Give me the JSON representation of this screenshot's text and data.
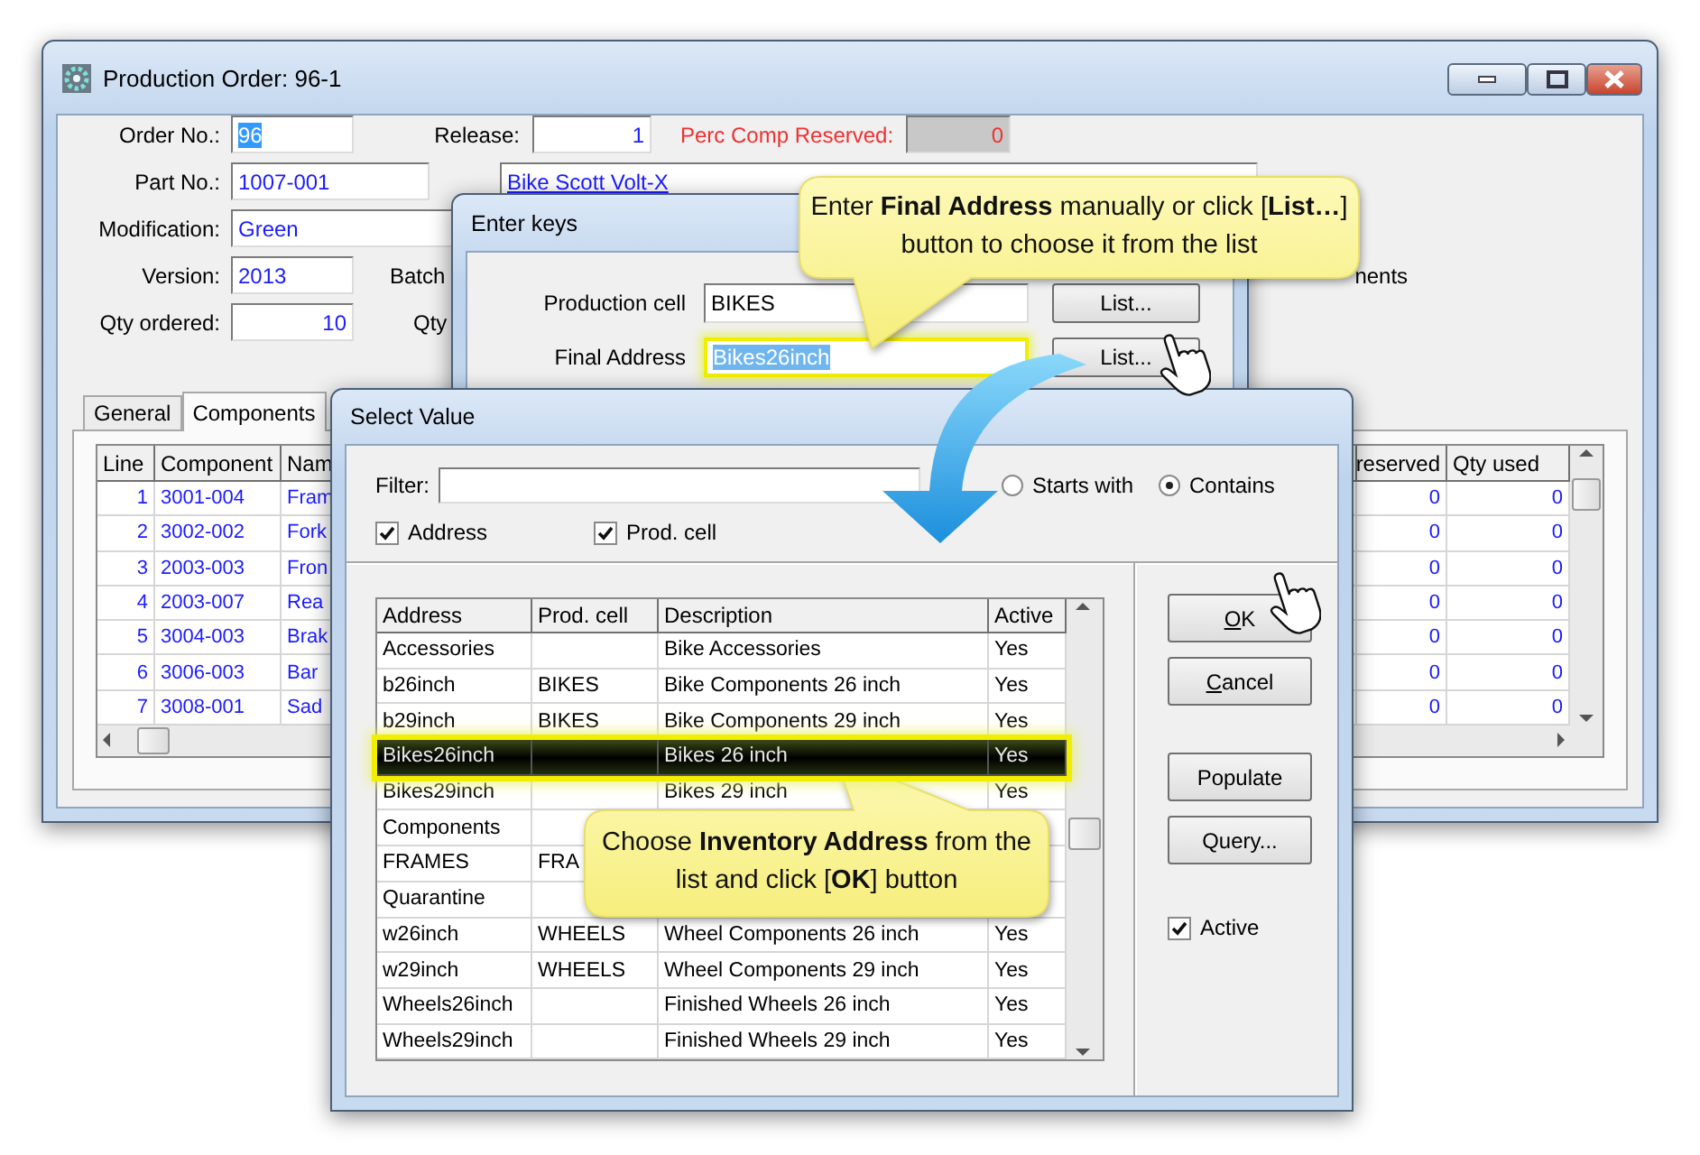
{
  "main_window": {
    "title": "Production Order: 96-1",
    "form_rows": [
      [
        {
          "label": "Order No.:",
          "value": "96",
          "kind": "text",
          "selected": true
        },
        {
          "label": "Release:",
          "value": "1",
          "kind": "number",
          "selected": false
        },
        {
          "label": "Perc Comp Reserved:",
          "value": "0",
          "kind": "readonly",
          "selected": false
        }
      ],
      [
        {
          "label": "Part No.:",
          "value": "1007-001",
          "kind": "text",
          "selected": false
        },
        {
          "value": "Bike Scott Volt-X",
          "kind": "description",
          "selected": false
        }
      ],
      [
        {
          "label": "Modification:",
          "value": "Green",
          "kind": "text",
          "selected": false
        }
      ],
      [
        {
          "label": "Version:",
          "value": "2013",
          "kind": "text",
          "selected": false
        },
        {
          "label": "Batch"
        },
        {
          "label": "nents"
        }
      ],
      [
        {
          "label": "Qty ordered:",
          "value": "10",
          "kind": "number",
          "selected": false
        },
        {
          "label": "Qty"
        }
      ]
    ],
    "tabs": [
      {
        "label": "General",
        "selected": false
      },
      {
        "label": "Components",
        "selected": true
      }
    ],
    "table": {
      "columns": [
        "Line",
        "Component",
        "Nam",
        "reserved",
        "Qty used"
      ],
      "rows": [
        [
          "1",
          "3001-004",
          "Fram",
          "0",
          "0"
        ],
        [
          "2",
          "3002-002",
          "Fork",
          "0",
          "0"
        ],
        [
          "3",
          "2003-003",
          "Fron",
          "0",
          "0"
        ],
        [
          "4",
          "2003-007",
          "Rea",
          "0",
          "0"
        ],
        [
          "5",
          "3004-003",
          "Brak",
          "0",
          "0"
        ],
        [
          "6",
          "3006-003",
          "Bar",
          "0",
          "0"
        ],
        [
          "7",
          "3008-001",
          "Sad",
          "0",
          "0"
        ]
      ]
    }
  },
  "enter_keys": {
    "title": "Enter keys",
    "fields": [
      {
        "label": "Production cell",
        "value": "BIKES",
        "selected": false,
        "highlighted": false,
        "button": "List..."
      },
      {
        "label": "Final Address",
        "value": "Bikes26inch",
        "selected": true,
        "highlighted": true,
        "button": "List..."
      }
    ]
  },
  "select_value": {
    "title": "Select Value",
    "filter": {
      "label": "Filter:"
    },
    "match_options": [
      {
        "label": "Starts with",
        "selected": false
      },
      {
        "label": "Contains",
        "selected": true
      }
    ],
    "search_in": [
      {
        "label": "Address",
        "checked": true
      },
      {
        "label": "Prod. cell",
        "checked": true
      }
    ],
    "table": {
      "columns": [
        "Address",
        "Prod. cell",
        "Description",
        "Active"
      ],
      "rows": [
        {
          "address": "Accessories",
          "description": "Bike Accessories",
          "active": "Yes",
          "selected": false
        },
        {
          "address": "b26inch",
          "prod_cell": "BIKES",
          "description": "Bike Components 26 inch",
          "active": "Yes",
          "selected": false
        },
        {
          "address": "b29inch",
          "prod_cell": "BIKES",
          "description": "Bike Components 29 inch",
          "active": "Yes",
          "selected": false
        },
        {
          "address": "Bikes26inch",
          "description": "Bikes 26 inch",
          "active": "Yes",
          "selected": true
        },
        {
          "address": "Bikes29inch",
          "description": "Bikes 29 inch",
          "active": "Yes",
          "selected": false
        },
        {
          "address": "Components",
          "selected": false
        },
        {
          "address": "FRAMES",
          "prod_cell": "FRA",
          "selected": false
        },
        {
          "address": "Quarantine",
          "selected": false
        },
        {
          "address": "w26inch",
          "prod_cell": "WHEELS",
          "description": "Wheel Components 26 inch",
          "active": "Yes",
          "selected": false
        },
        {
          "address": "w29inch",
          "prod_cell": "WHEELS",
          "description": "Wheel Components 29 inch",
          "active": "Yes",
          "selected": false
        },
        {
          "address": "Wheels26inch",
          "description": "Finished Wheels 26 inch",
          "active": "Yes",
          "selected": false
        },
        {
          "address": "Wheels29inch",
          "description": "Finished Wheels 29 inch",
          "active": "Yes",
          "selected": false
        }
      ]
    },
    "buttons": [
      {
        "label": "OK",
        "access_key": true
      },
      {
        "label": "Cancel",
        "access_key": true
      },
      {
        "label": "Populate",
        "access_key": false
      },
      {
        "label": "Query...",
        "access_key": false
      }
    ],
    "active_filter": {
      "label": "Active",
      "checked": true
    }
  },
  "callouts": [
    {
      "text": "Enter **Final Address** manually or click [**List…**] button to choose it from the list"
    },
    {
      "text": "Choose **Inventory Address** from the list and click [**OK**] button"
    }
  ]
}
